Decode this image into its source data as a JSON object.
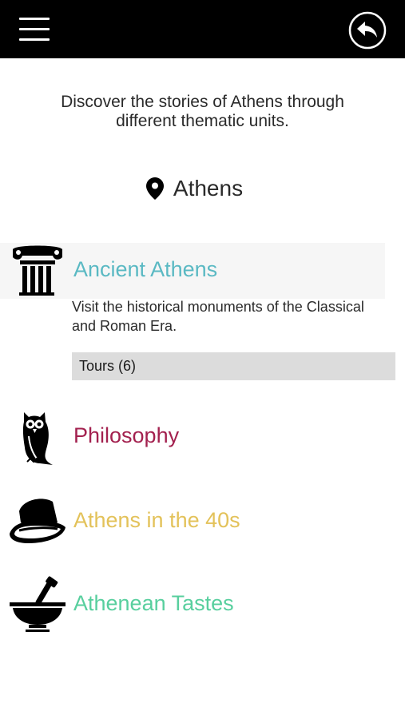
{
  "header": {
    "menu_icon": "hamburger-menu-icon",
    "back_icon": "back-arrow-icon"
  },
  "intro": {
    "text": "Discover the stories of Athens through different thematic units."
  },
  "location": {
    "icon": "location-pin-icon",
    "name": "Athens"
  },
  "units": [
    {
      "title": "Ancient Athens",
      "icon": "column-icon",
      "color": "#5ab9c3",
      "description": "Visit the historical monuments of the Classical and Roman Era.",
      "tours_label": "Tours (6)",
      "expanded": true
    },
    {
      "title": "Philosophy",
      "icon": "owl-icon",
      "color": "#a3214f"
    },
    {
      "title": "Athens in the 40s",
      "icon": "fedora-hat-icon",
      "color": "#e3c25a"
    },
    {
      "title": "Athenean Tastes",
      "icon": "mortar-pestle-icon",
      "color": "#58cf9e"
    }
  ]
}
